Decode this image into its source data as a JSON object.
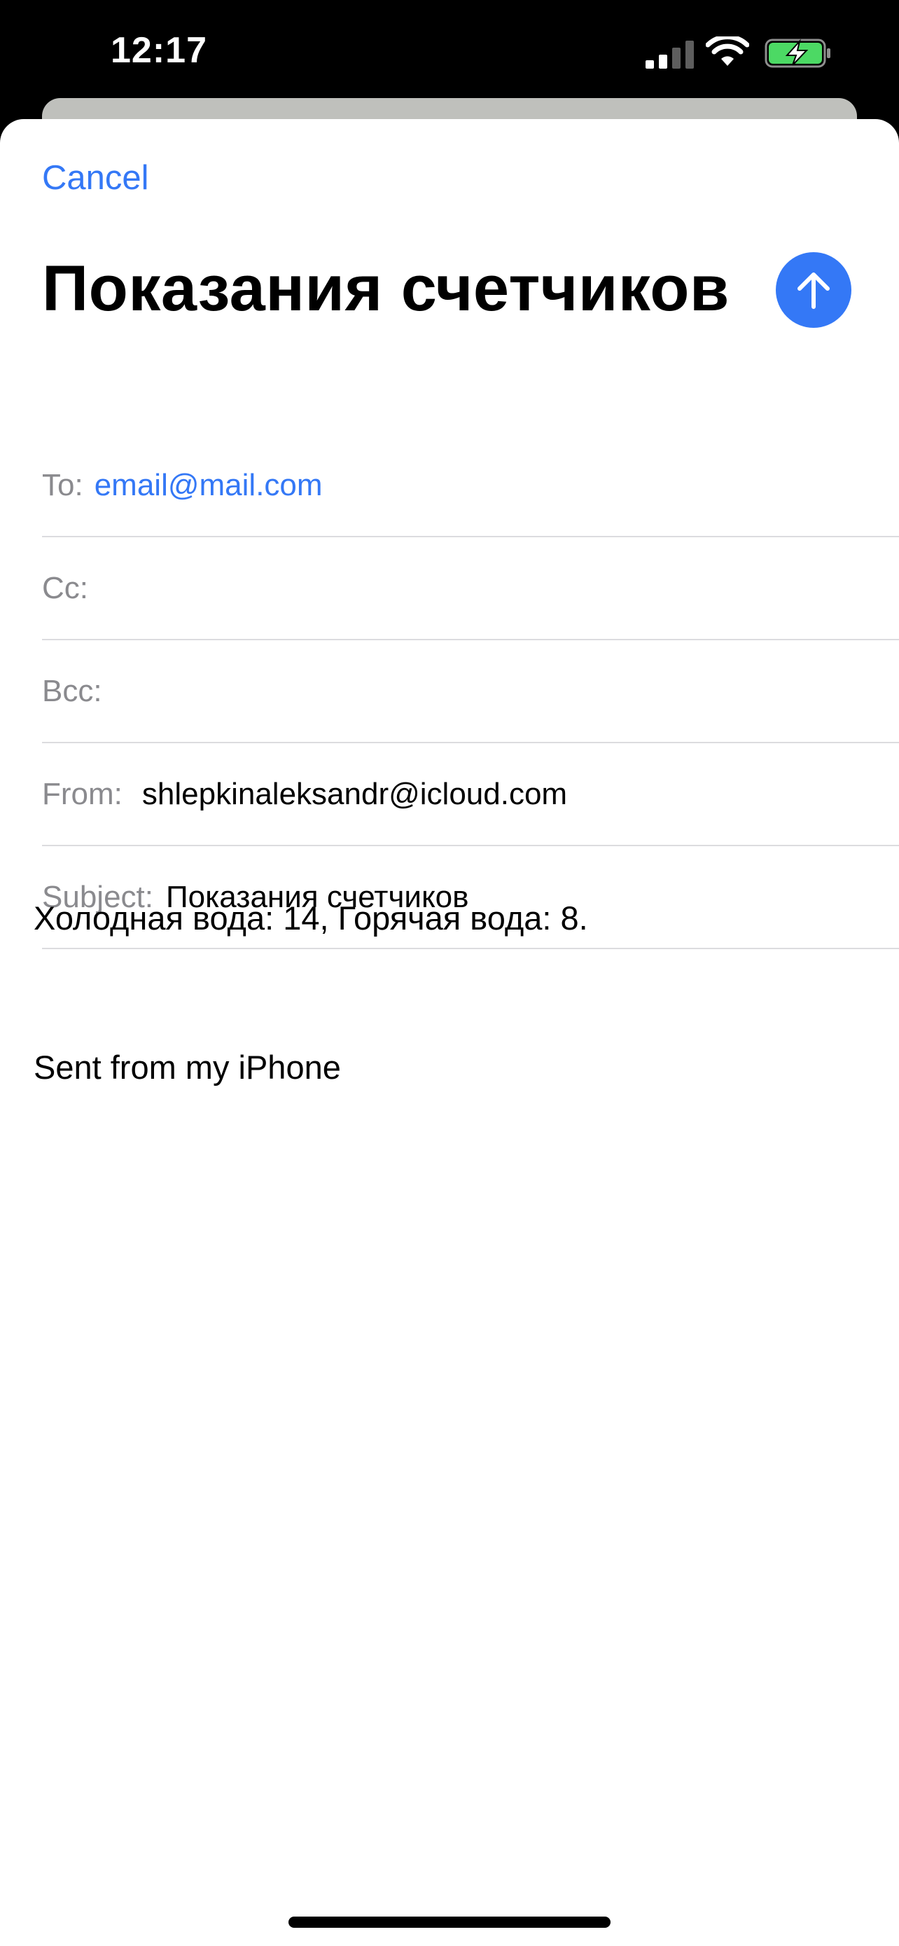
{
  "status_bar": {
    "time": "12:17",
    "icons": [
      "cellular-signal-icon",
      "wifi-icon",
      "battery-charging-icon"
    ],
    "battery_color": "#4cd964"
  },
  "compose": {
    "cancel_label": "Cancel",
    "title": "Показания счетчиков",
    "send_icon": "arrow-up-icon",
    "accent_color": "#3478f6",
    "fields": {
      "to": {
        "label": "To:",
        "value": "email@mail.com"
      },
      "cc": {
        "label": "Cc:",
        "value": ""
      },
      "bcc": {
        "label": "Bcc:",
        "value": ""
      },
      "from": {
        "label": "From:",
        "value": "shlepkinaleksandr@icloud.com"
      },
      "subject": {
        "label": "Subject:",
        "value": "Показания счетчиков"
      }
    },
    "body": "Холодная вода: 14, Горячая вода: 8.",
    "signature": "Sent from my iPhone"
  }
}
